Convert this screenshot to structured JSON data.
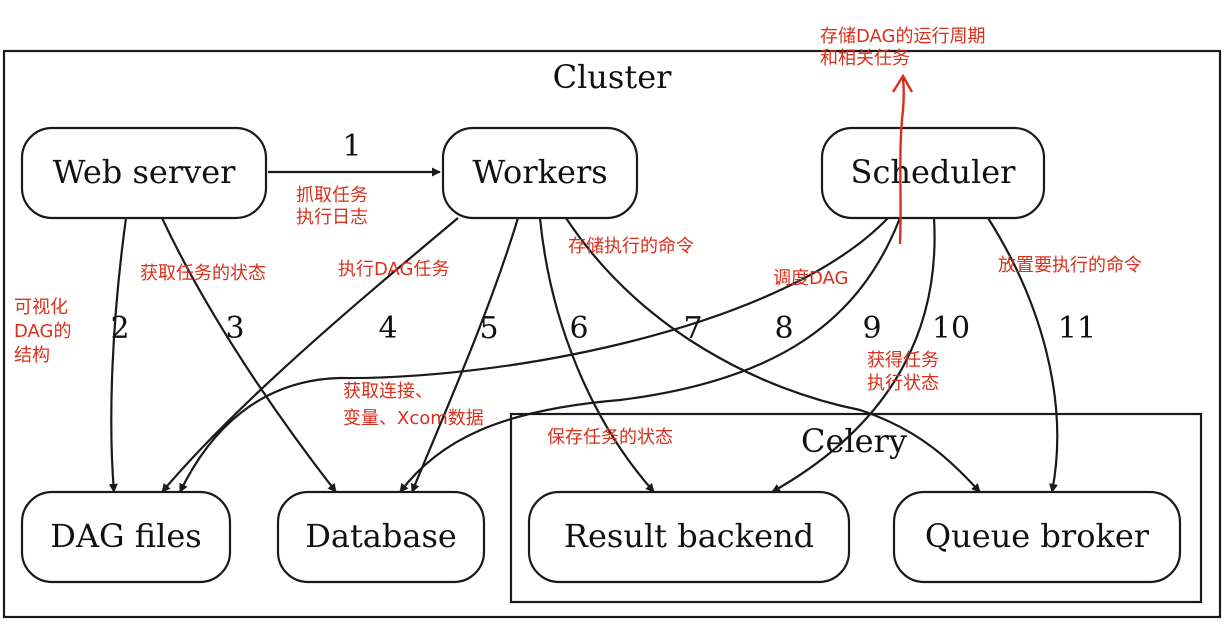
{
  "diagram": {
    "cluster_label": "Cluster",
    "celery_label": "Celery",
    "nodes": {
      "web_server": "Web server",
      "workers": "Workers",
      "scheduler": "Scheduler",
      "dag_files": "DAG files",
      "database": "Database",
      "result_backend": "Result backend",
      "queue_broker": "Queue broker"
    },
    "edge_numbers": [
      "1",
      "2",
      "3",
      "4",
      "5",
      "6",
      "7",
      "8",
      "9",
      "10",
      "11"
    ],
    "annotations": {
      "top_1": "存储DAG的运行周期",
      "top_2": "和相关任务",
      "fetch_log_1": "抓取任务",
      "fetch_log_2": "执行日志",
      "visualize_1": "可视化",
      "visualize_2": "DAG的",
      "visualize_3": "结构",
      "get_task_status": "获取任务的状态",
      "execute_dag": "执行DAG任务",
      "store_cmd": "存储执行的命令",
      "schedule_dag": "调度DAG",
      "put_cmd": "放置要执行的命令",
      "get_exec_1": "获得任务",
      "get_exec_2": "执行状态",
      "get_conn_1": "获取连接、",
      "get_conn_2": "变量、Xcom数据",
      "save_status": "保存任务的状态"
    }
  }
}
